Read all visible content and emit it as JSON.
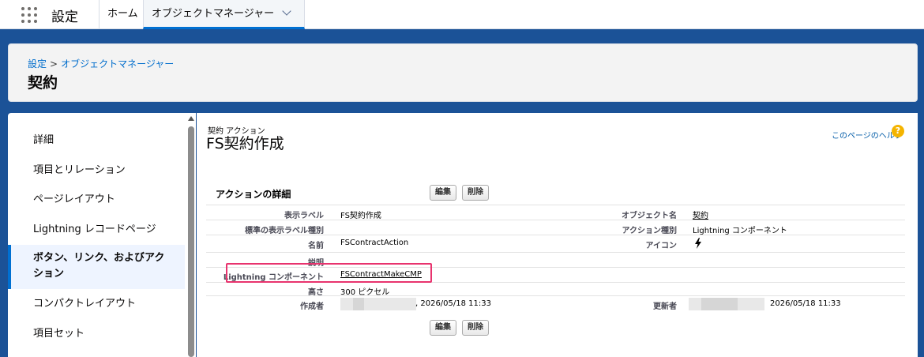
{
  "topbar": {
    "app_name": "設定",
    "tabs": [
      "ホーム",
      "オブジェクトマネージャー"
    ]
  },
  "header": {
    "breadcrumb_root": "設定",
    "breadcrumb_sep": ">",
    "breadcrumb_current": "オブジェクトマネージャー",
    "title": "契約"
  },
  "sidebar": {
    "items": [
      "詳細",
      "項目とリレーション",
      "ページレイアウト",
      "Lightning レコードページ",
      "ボタン、リンク、およびアク",
      "ション",
      "コンパクトレイアウト",
      "項目セット"
    ]
  },
  "main": {
    "subtitle": "契約 アクション",
    "title": "FS契約作成",
    "help_link": "このページのヘルプ",
    "help_icon": "?",
    "section_title": "アクションの詳細",
    "edit_button": "編集",
    "delete_button": "削除",
    "fields": {
      "display_label_label": "表示ラベル",
      "display_label_value": "FS契約作成",
      "standard_label_type_label": "標準の表示ラベル種別",
      "name_label": "名前",
      "name_value": "FSContractAction",
      "description_label": "説明",
      "lightning_component_label": "Lightning コンポーネント",
      "lightning_component_value": "FSContractMakeCMP",
      "height_label": "高さ",
      "height_value": "300 ピクセル",
      "created_by_label": "作成者",
      "created_by_date": ", 2026/05/18 11:33",
      "object_name_label": "オブジェクト名",
      "object_name_value": "契約",
      "action_type_label": "アクション種別",
      "action_type_value": "Lightning コンポーネント",
      "icon_label": "アイコン",
      "icon_value": "lightning-bolt-icon",
      "modified_by_label": "更新者",
      "modified_by_date": "2026/05/18 11:33"
    }
  },
  "colors": {
    "background": "#1b5297",
    "link": "#006dcc",
    "highlight": "#e8336e",
    "help_icon": "#f4b400"
  }
}
